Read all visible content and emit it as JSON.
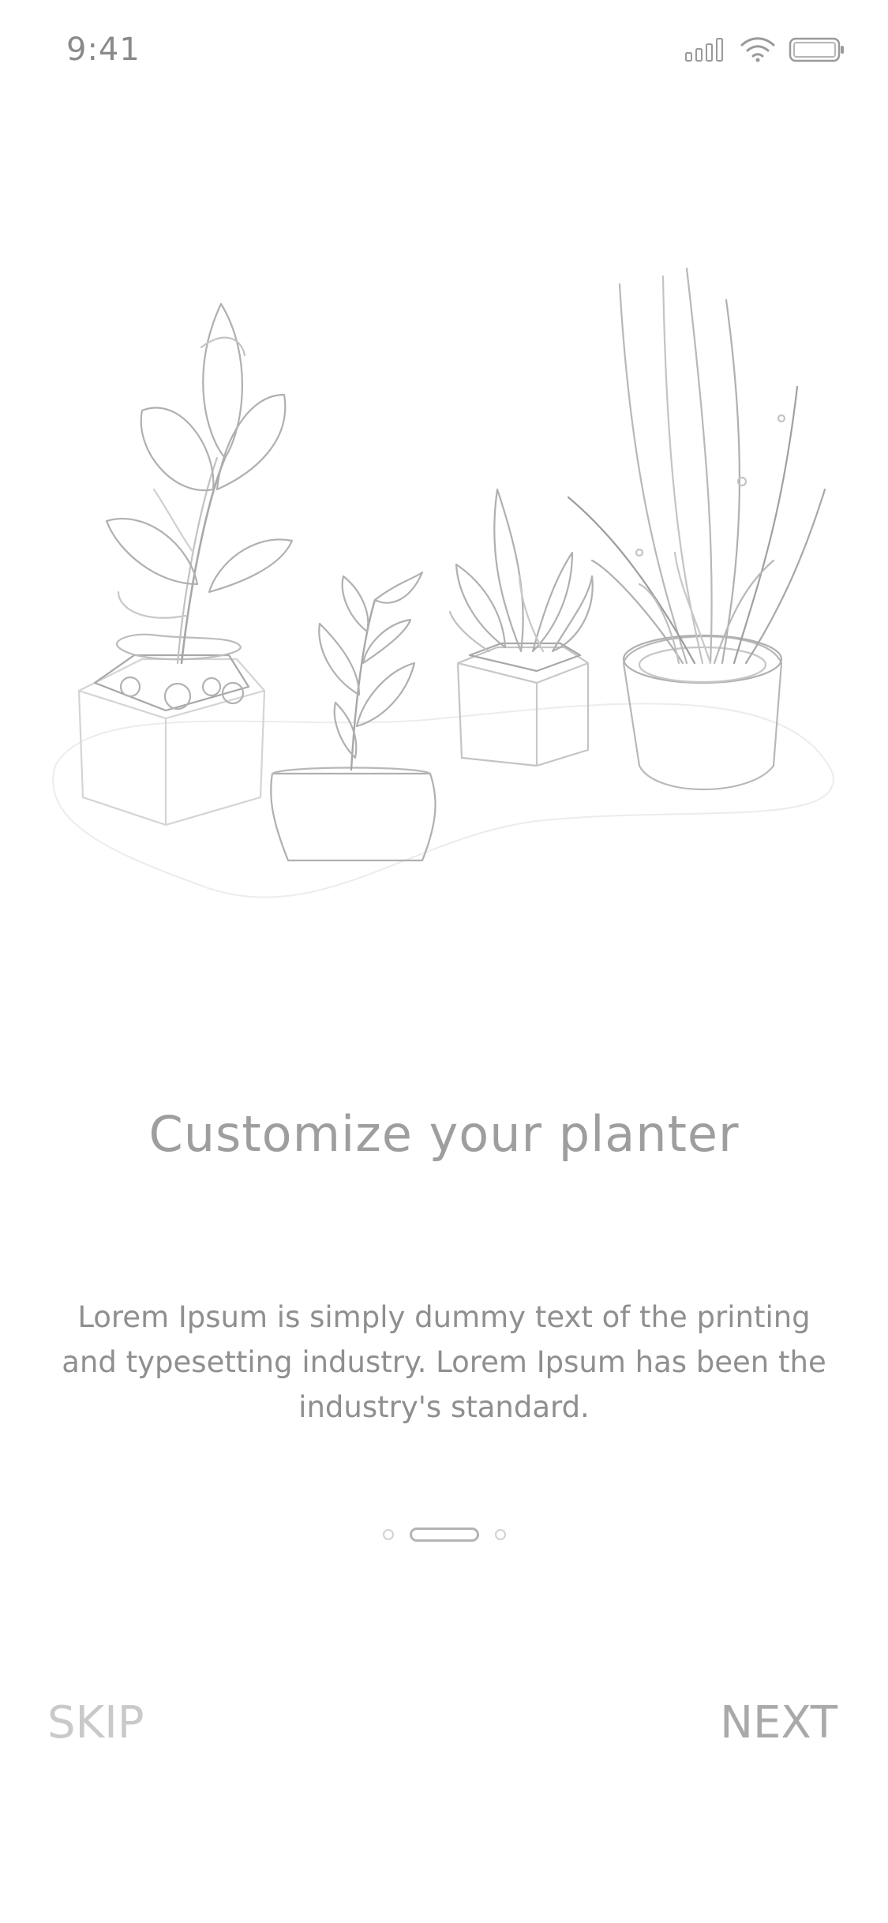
{
  "status_bar": {
    "time": "9:41",
    "icons": [
      "cellular-signal-icon",
      "wifi-icon",
      "battery-icon"
    ]
  },
  "illustration": {
    "subject": "potted-plants-illustration"
  },
  "onboarding": {
    "title": "Customize your planter",
    "description": "Lorem Ipsum is simply dummy text of the printing and typesetting industry. Lorem Ipsum has been the industry's standard.",
    "page_count": 3,
    "current_page": 2
  },
  "actions": {
    "skip_label": "SKIP",
    "next_label": "NEXT"
  },
  "colors": {
    "background": "#ffffff",
    "line_art": "#b8b8b8",
    "title_text": "#9e9e9e",
    "body_text": "#8f8f8f",
    "skip_text": "#c9c9c9",
    "next_text": "#a9a9a9"
  }
}
